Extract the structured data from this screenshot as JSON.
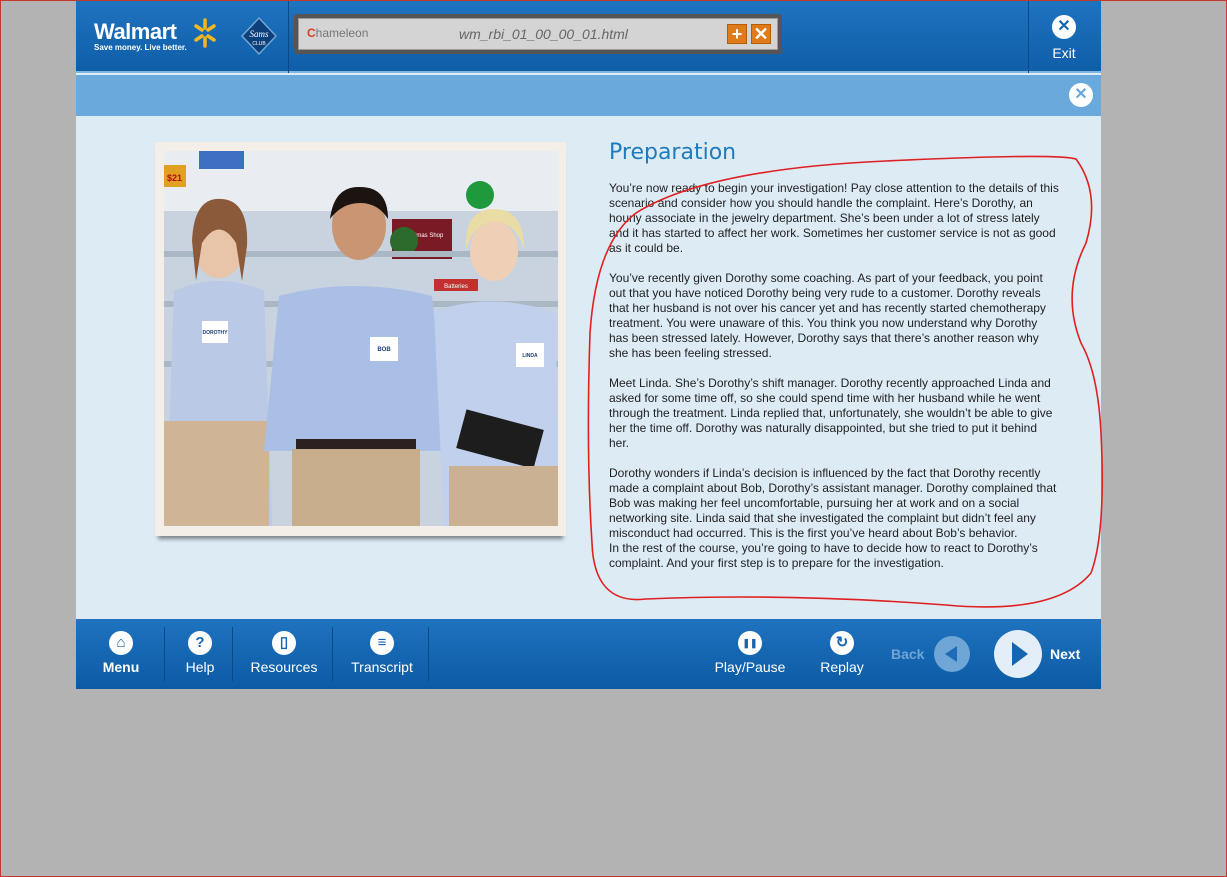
{
  "header": {
    "brand_name": "Walmart",
    "brand_tagline": "Save money. Live better.",
    "sams_label": "Sams",
    "sams_sub": "CLUB",
    "browser_brand": "hameleon",
    "browser_brand_initial": "C",
    "file_name": "wm_rbi_01_00_00_01.html",
    "plus_symbol": "+",
    "close_symbol": "✕",
    "exit_label": "Exit"
  },
  "photo": {
    "badges": [
      "DOROTHY",
      "BOB",
      "LINDA"
    ],
    "sign_text": "Christmas Shop",
    "price_tag": "$21",
    "battery_sign": "Batteries"
  },
  "content": {
    "title": "Preparation",
    "paragraphs": [
      "You’re now ready to begin your investigation!  Pay close attention to the details of this scenario and consider how you should handle the complaint.  Here’s Dorothy, an hourly associate in the jewelry department.  She’s been under a lot of stress lately and it has started to affect her work.  Sometimes her customer service is not as good as it could be.",
      "You’ve recently given Dorothy some coaching.  As part of your feedback, you point out that you have noticed Dorothy being very rude to a customer.  Dorothy reveals that her husband is not over his cancer yet and has recently started chemotherapy treatment.  You were unaware of this.  You think you now understand why Dorothy has been stressed lately.  However, Dorothy says that there’s another reason why she has been feeling stressed.",
      "Meet Linda.  She’s Dorothy’s shift manager.  Dorothy recently approached Linda and asked for some time off, so she could spend time with her husband while he went through the treatment.  Linda replied that, unfortunately, she wouldn’t be able to give her the time off.  Dorothy was naturally disappointed, but she tried to put it behind her.",
      "Dorothy wonders if Linda’s decision is influenced by the fact that Dorothy recently made a complaint about Bob, Dorothy’s assistant manager.  Dorothy complained that Bob was making her feel uncomfortable, pursuing her at work and on a social networking site.  Linda said that she investigated the complaint but didn’t feel any misconduct had occurred.  This is the first you’ve heard about Bob’s behavior.",
      "In the rest of the course, you’re going to have to decide how to react to Dorothy’s complaint.  And your first step is to prepare for the investigation."
    ]
  },
  "footer": {
    "menu": "Menu",
    "help": "Help",
    "resources": "Resources",
    "transcript": "Transcript",
    "play_pause": "Play/Pause",
    "replay": "Replay",
    "back": "Back",
    "next": "Next",
    "help_glyph": "?",
    "play_glyph": "❚❚",
    "replay_glyph": "↻",
    "transcript_glyph": "≡"
  },
  "colors": {
    "header_blue": "#1f73bf",
    "subbar_blue": "#6aa9dc",
    "content_bg": "#ddebf5",
    "title_blue": "#1e7bbd",
    "annotation_red": "#e02020",
    "walmart_spark": "#f5b81c"
  },
  "icons": {
    "exit": "close-circle-icon",
    "menu": "home-icon",
    "help": "question-icon",
    "resources": "document-icon",
    "transcript": "list-icon",
    "play_pause": "pause-icon",
    "replay": "replay-icon",
    "back": "arrow-left-icon",
    "next": "arrow-right-icon"
  }
}
